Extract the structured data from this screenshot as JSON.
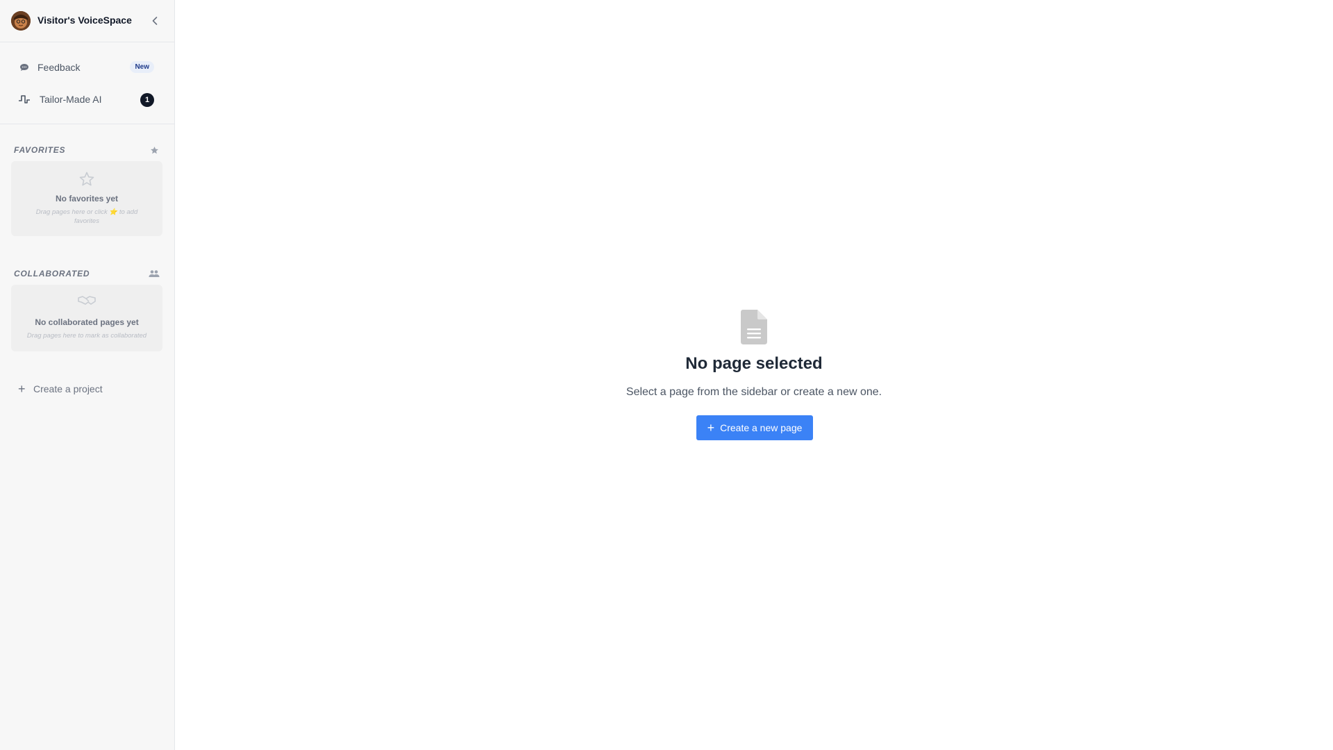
{
  "sidebar": {
    "workspace_name": "Visitor's VoiceSpace",
    "nav": [
      {
        "label": "Feedback",
        "icon": "chat-bubble-icon",
        "badge": "New"
      },
      {
        "label": "Tailor-Made AI",
        "icon": "pulse-icon",
        "count": "1"
      }
    ],
    "favorites": {
      "title": "FAVORITES",
      "empty_title": "No favorites yet",
      "empty_hint": "Drag pages here or click ⭐ to add favorites"
    },
    "collaborated": {
      "title": "COLLABORATED",
      "empty_title": "No collaborated pages yet",
      "empty_hint": "Drag pages here to mark as collaborated"
    },
    "create_project": "Create a project"
  },
  "main": {
    "empty_title": "No page selected",
    "empty_subtitle": "Select a page from the sidebar or create a new one.",
    "create_button": "Create a new page"
  },
  "colors": {
    "accent": "#3b82f6",
    "sidebar_bg": "#f7f7f7",
    "badge_dark": "#111827"
  }
}
